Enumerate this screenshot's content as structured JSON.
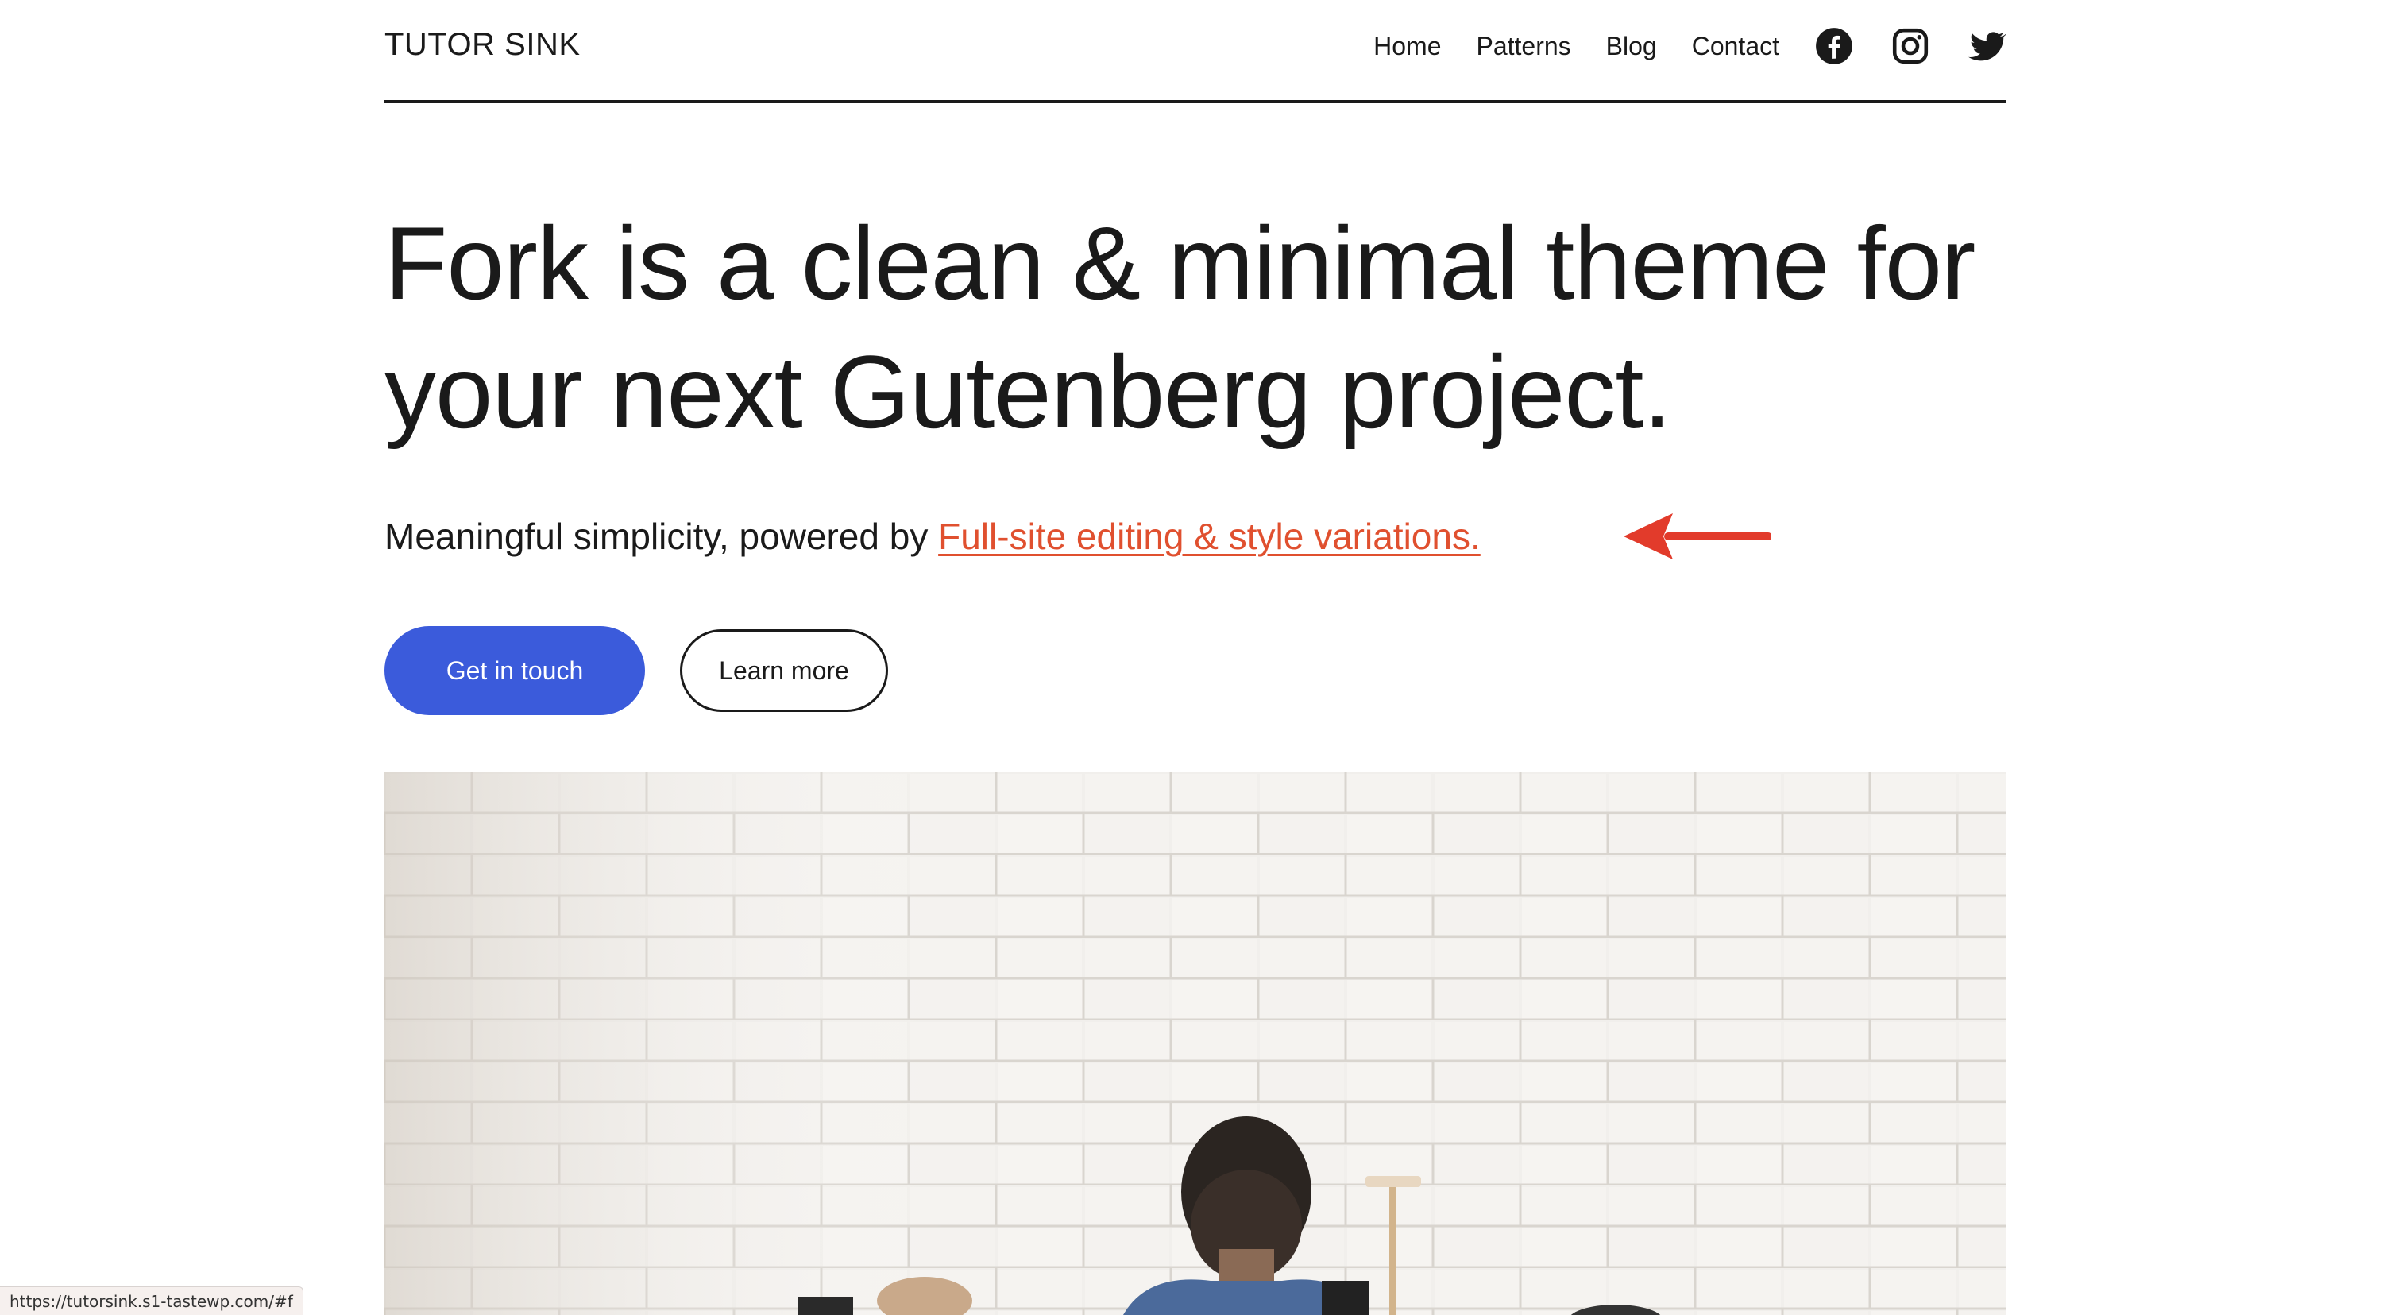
{
  "header": {
    "site_title": "TUTOR SINK",
    "nav": [
      "Home",
      "Patterns",
      "Blog",
      "Contact"
    ],
    "social": [
      "facebook-icon",
      "instagram-icon",
      "twitter-icon"
    ]
  },
  "hero": {
    "title": "Fork is a clean & minimal theme for your next Gutenberg project.",
    "subtitle_prefix": "Meaningful simplicity, powered by ",
    "subtitle_link": "Full-site editing & style variations.",
    "primary_button": "Get in touch",
    "secondary_button": "Learn more"
  },
  "status_bar": {
    "url": "https://tutorsink.s1-tastewp.com/#f"
  },
  "colors": {
    "accent_link": "#e0502f",
    "primary_button": "#3b5bdb",
    "annotation_arrow": "#e23b2b",
    "text": "#1a1a1a"
  }
}
